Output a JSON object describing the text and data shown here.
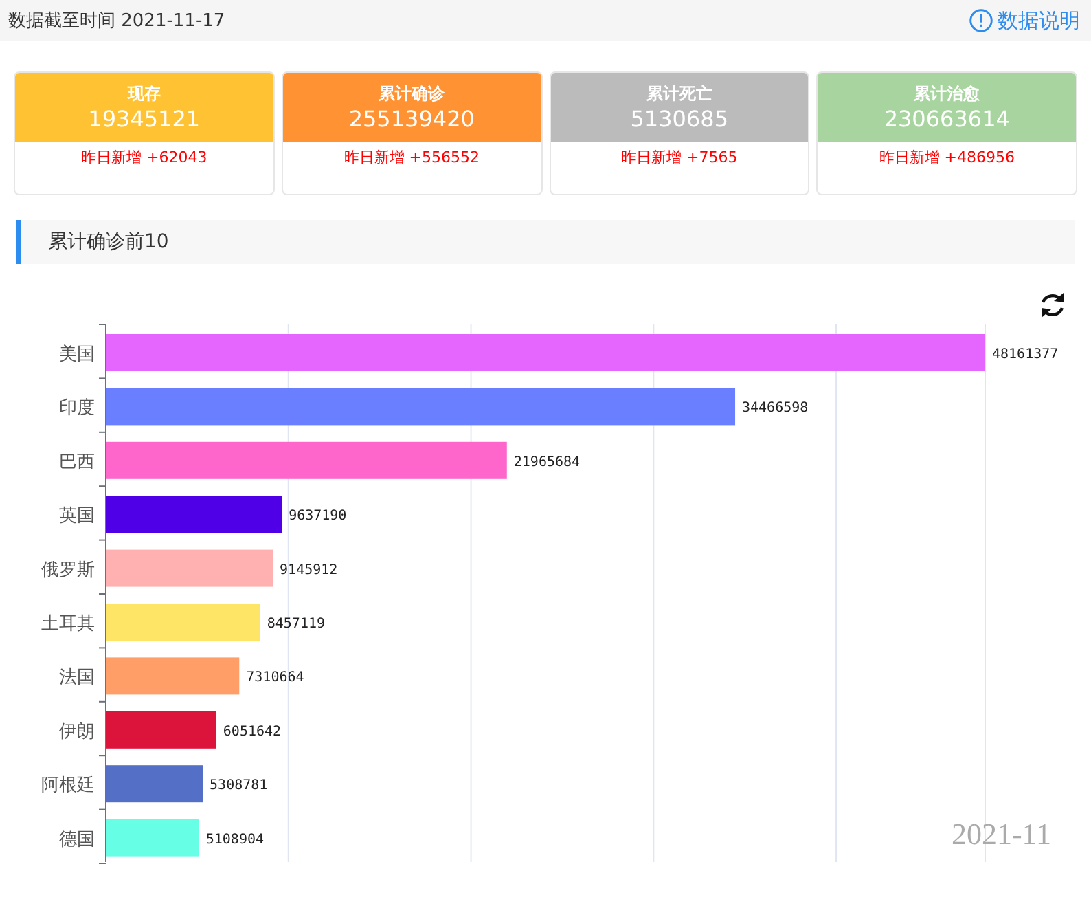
{
  "header": {
    "update_time": "数据截至时间 2021-11-17",
    "help_link": "数据说明"
  },
  "stat_cards": [
    {
      "title": "现存",
      "value": "19345121",
      "delta": "昨日新增 +62043",
      "color": "#ffc232"
    },
    {
      "title": "累计确诊",
      "value": "255139420",
      "delta": "昨日新增 +556552",
      "color": "#ff9232"
    },
    {
      "title": "累计死亡",
      "value": "5130685",
      "delta": "昨日新增 +7565",
      "color": "#bbbbbb"
    },
    {
      "title": "累计治愈",
      "value": "230663614",
      "delta": "昨日新增 +486956",
      "color": "#a8d59f"
    }
  ],
  "section": {
    "title": "累计确诊前10"
  },
  "chart": {
    "timeline_label": "2021-11",
    "chart_data": {
      "type": "bar",
      "orientation": "horizontal",
      "data_labels": true,
      "categories": [
        "美国",
        "印度",
        "巴西",
        "英国",
        "俄罗斯",
        "土耳其",
        "法国",
        "伊朗",
        "阿根廷",
        "德国"
      ],
      "values": [
        48161377,
        34466598,
        21965684,
        9637190,
        9145912,
        8457119,
        7310664,
        6051642,
        5308781,
        5108904
      ],
      "colors": [
        "#e566ff",
        "#6a7fff",
        "#ff66cc",
        "#5000e6",
        "#ffb0b0",
        "#ffe566",
        "#ff9e66",
        "#dc143c",
        "#5470c6",
        "#66ffe6"
      ],
      "xlim": [
        0,
        48161377
      ]
    }
  }
}
